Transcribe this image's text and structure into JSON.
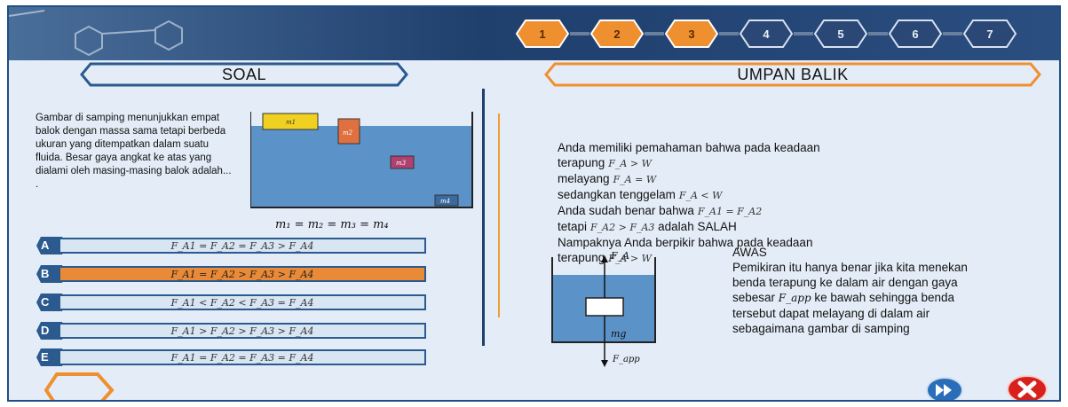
{
  "header": {
    "steps": [
      {
        "label": "1",
        "state": "done"
      },
      {
        "label": "2",
        "state": "done"
      },
      {
        "label": "3",
        "state": "active"
      },
      {
        "label": "4",
        "state": "pending"
      },
      {
        "label": "5",
        "state": "pending"
      },
      {
        "label": "6",
        "state": "pending"
      },
      {
        "label": "7",
        "state": "pending"
      }
    ]
  },
  "soal": {
    "title": "SOAL",
    "question": "Gambar di samping menunjukkan empat balok dengan massa sama tetapi berbeda ukuran yang ditempatkan dalam suatu fluida. Besar gaya angkat ke atas yang dialami oleh masing-masing balok adalah... .",
    "diagram": {
      "labels": [
        "m1",
        "m2",
        "m3",
        "m4"
      ]
    },
    "masses_equation": "m₁ = m₂ = m₃ = m₄",
    "options": [
      {
        "letter": "A",
        "text": "F_A1 = F_A2 = F_A3 > F_A4",
        "selected": false
      },
      {
        "letter": "B",
        "text": "F_A1 = F_A2 > F_A3 > F_A4",
        "selected": true
      },
      {
        "letter": "C",
        "text": "F_A1 < F_A2 < F_A3 = F_A4",
        "selected": false
      },
      {
        "letter": "D",
        "text": "F_A1 > F_A2 > F_A3 > F_A4",
        "selected": false
      },
      {
        "letter": "E",
        "text": "F_A1 = F_A2 = F_A3 = F_A4",
        "selected": false
      }
    ]
  },
  "umpan_balik": {
    "title": "UMPAN BALIK",
    "lines": [
      {
        "text": "Anda memiliki pemahaman bahwa pada keadaan",
        "math": ""
      },
      {
        "text": "terapung",
        "math": "F_A > W"
      },
      {
        "text": "melayang",
        "math": "F_A = W"
      },
      {
        "text": "sedangkan tenggelam",
        "math": "F_A < W"
      },
      {
        "text": "Anda sudah benar bahwa",
        "math": "F_A1 = F_A2"
      },
      {
        "text": "tetapi",
        "math": "F_A2 > F_A3",
        "after": "adalah SALAH"
      },
      {
        "text": "Nampaknya Anda berpikir bahwa pada keadaan",
        "math": ""
      },
      {
        "text": "terapung",
        "math": "F_A > W"
      }
    ],
    "diagram_labels": {
      "top": "F_A",
      "mid": "mg",
      "bottom": "F_app"
    },
    "awas_title": "AWAS",
    "awas_text": "Pemikiran itu hanya benar jika kita menekan benda terapung ke dalam air dengan gaya sebesar",
    "awas_force": "F_app",
    "awas_text2": "ke bawah sehingga benda tersebut dapat melayang di dalam air sebagaimana gambar di samping"
  },
  "colors": {
    "accent": "#ea8a36",
    "navy": "#1f3f6d",
    "water": "#5b93c8"
  },
  "buttons": {
    "next_icon": "fast-forward-icon",
    "close_icon": "close-icon"
  }
}
